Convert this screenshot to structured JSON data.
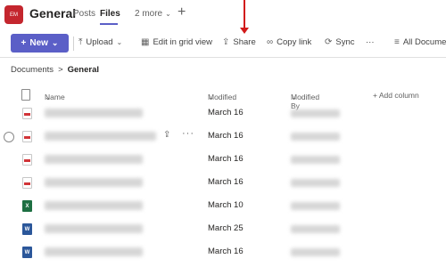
{
  "header": {
    "avatar_text": "EM",
    "channel": "General",
    "tabs": [
      {
        "label": "Posts"
      },
      {
        "label": "Files"
      },
      {
        "label": "2 more"
      }
    ],
    "add_tab": "+"
  },
  "toolbar": {
    "new_label": "New",
    "upload_label": "Upload",
    "grid_label": "Edit in grid view",
    "share_label": "Share",
    "copylink_label": "Copy link",
    "sync_label": "Sync",
    "more": "···",
    "alldocs_label": "All Documents"
  },
  "breadcrumb": {
    "root": "Documents",
    "separator": ">",
    "current": "General"
  },
  "columns": {
    "name": "Name",
    "modified": "Modified",
    "modified_by": "Modified By",
    "add_column": "+ Add column"
  },
  "rows": [
    {
      "type": "pdf",
      "modified": "March 16"
    },
    {
      "type": "pdf",
      "modified": "March 16"
    },
    {
      "type": "pdf",
      "modified": "March 16"
    },
    {
      "type": "pdf",
      "modified": "March 16"
    },
    {
      "type": "xls",
      "modified": "March 10"
    },
    {
      "type": "doc",
      "modified": "March 25"
    },
    {
      "type": "doc",
      "modified": "March 16"
    }
  ],
  "colors": {
    "accent": "#5b5fc7",
    "annotation_arrow": "#d21a1a",
    "team_avatar": "#c4262e"
  }
}
